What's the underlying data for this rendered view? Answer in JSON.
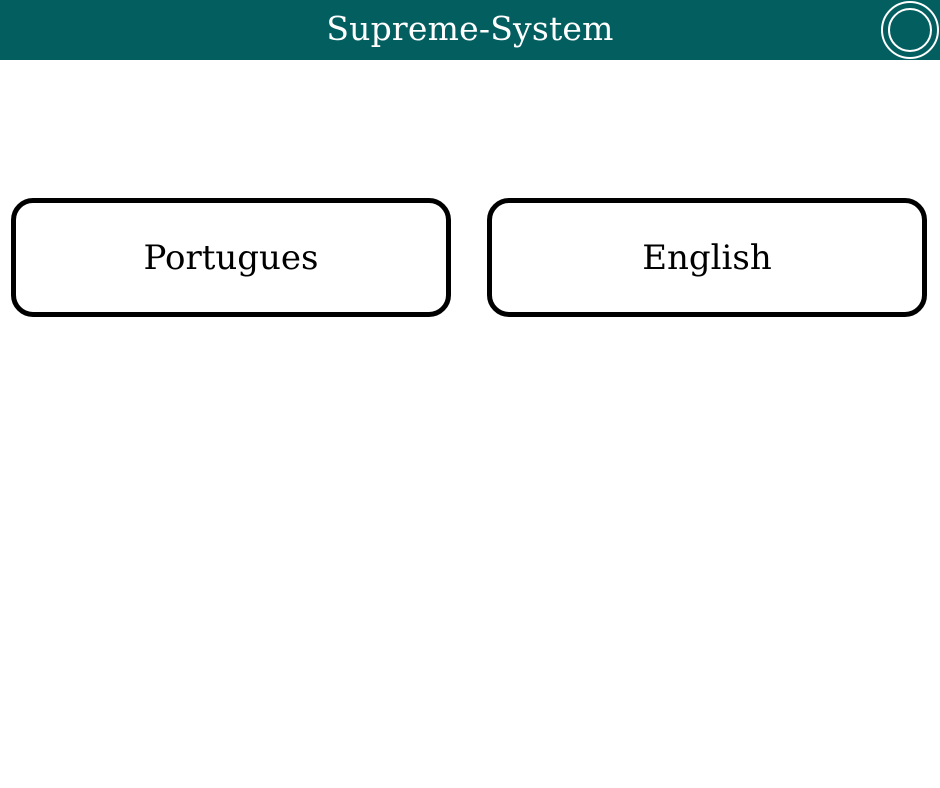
{
  "header": {
    "title": "Supreme-System",
    "background_color": "#035e60",
    "menu_icon": "double-circle-icon"
  },
  "language_options": [
    {
      "label": "Portugues"
    },
    {
      "label": "English"
    }
  ],
  "colors": {
    "page_background": "#ffffff",
    "button_border": "#000000",
    "header_text": "#ffffff"
  }
}
